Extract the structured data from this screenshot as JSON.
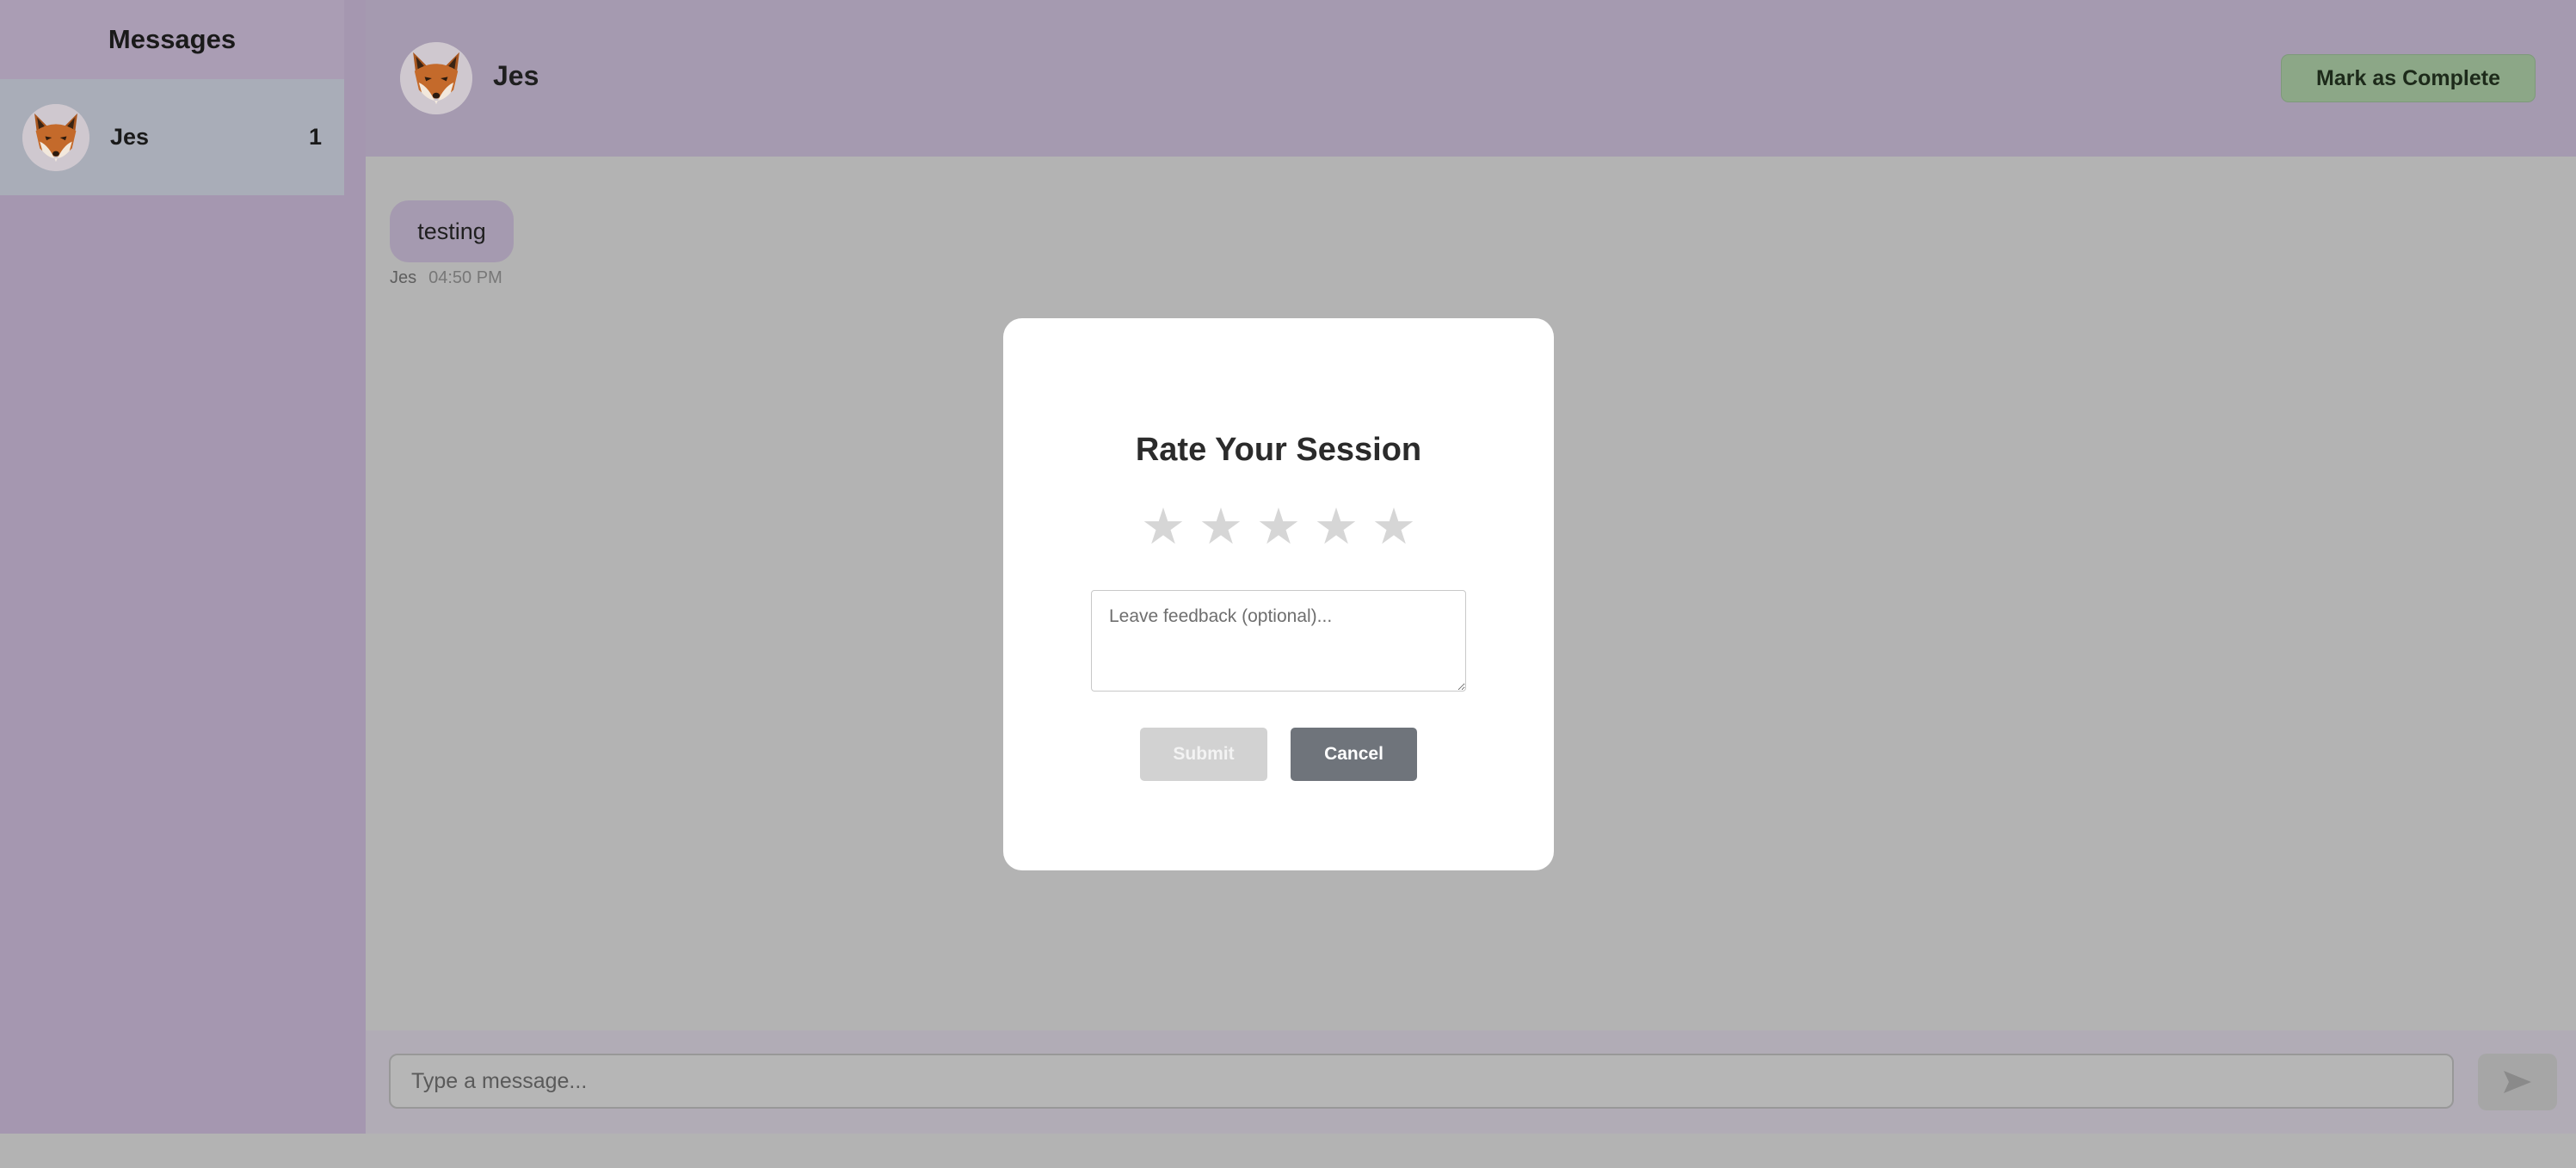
{
  "sidebar": {
    "title": "Messages",
    "items": [
      {
        "name": "Jes",
        "badge": "1",
        "avatar_icon": "fox-avatar-icon"
      }
    ]
  },
  "chat": {
    "header": {
      "name": "Jes",
      "complete_label": "Mark as Complete"
    },
    "messages": [
      {
        "text": "testing",
        "sender": "Jes",
        "time": "04:50 PM"
      }
    ],
    "composer": {
      "placeholder": "Type a message...",
      "send_icon": "send-icon"
    }
  },
  "modal": {
    "title": "Rate Your Session",
    "stars": [
      "★",
      "★",
      "★",
      "★",
      "★"
    ],
    "rating_selected": 0,
    "feedback_placeholder": "Leave feedback (optional)...",
    "submit_label": "Submit",
    "cancel_label": "Cancel"
  },
  "colors": {
    "sidebar_bg": "#a597b0",
    "header_bg": "#a59ab0",
    "complete_button": "#8ca787",
    "cancel_button": "#6f747b",
    "submit_disabled": "#d2d2d2",
    "star_empty": "#d6d6d6"
  }
}
